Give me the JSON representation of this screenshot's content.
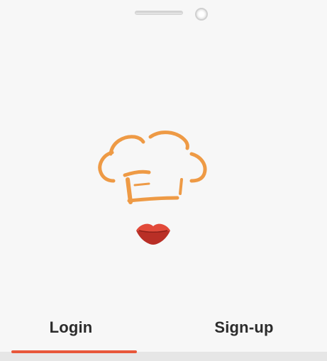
{
  "tabs": {
    "login_label": "Login",
    "signup_label": "Sign-up",
    "active": "login"
  },
  "logo": {
    "hat_icon": "chef-hat-icon",
    "lips_icon": "lips-icon"
  },
  "colors": {
    "accent": "#e8573a",
    "hat": "#ee9a45",
    "lips": "#d23b2e",
    "background": "#f7f7f7"
  }
}
